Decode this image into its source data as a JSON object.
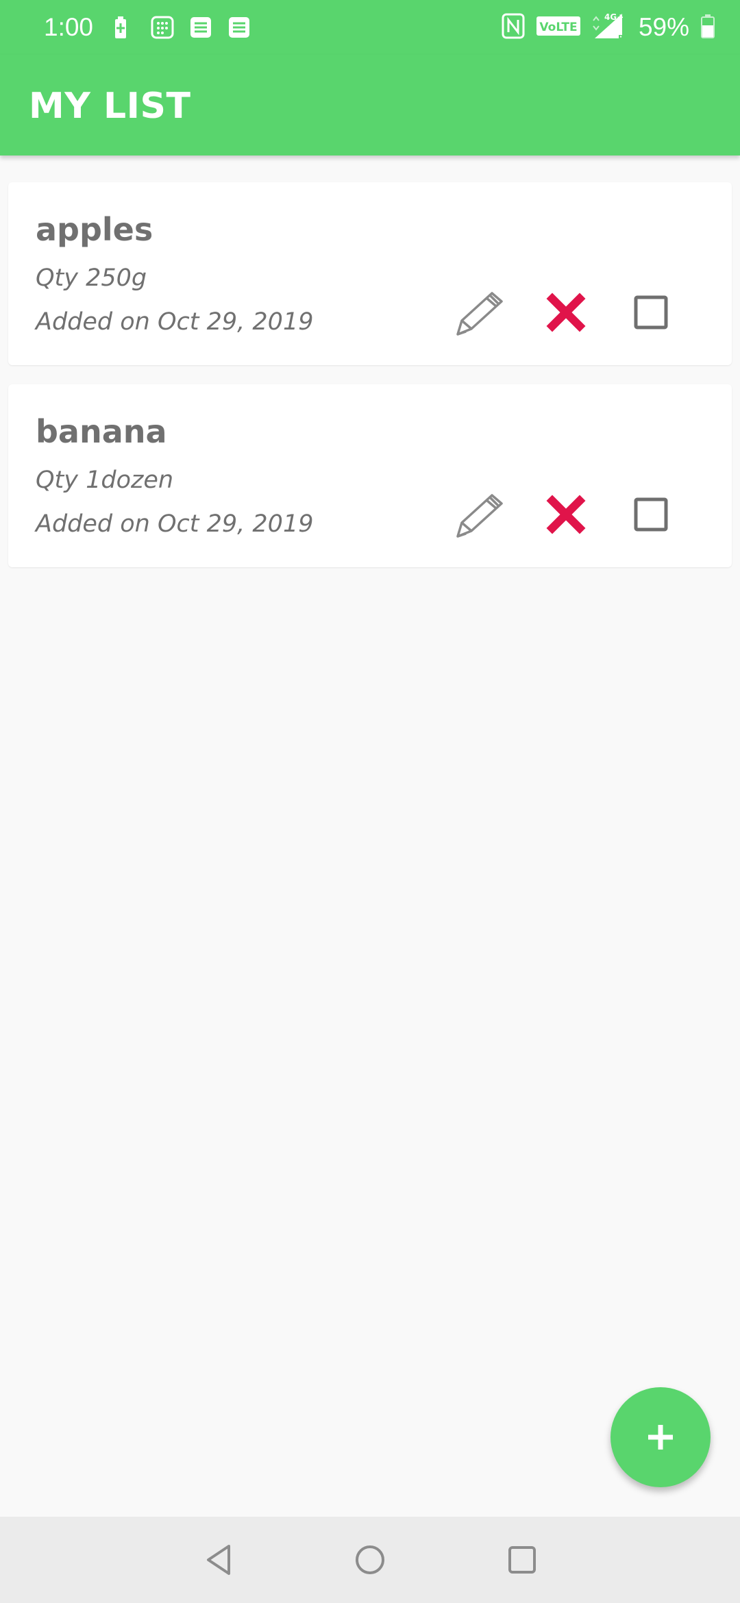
{
  "status_bar": {
    "time": "1:00",
    "battery_percent": "59%",
    "network_label": "VoLTE",
    "signal_label": "4G+",
    "roaming_label": "R",
    "left_icons": [
      "battery-charging-icon",
      "calculator-icon",
      "notes-icon",
      "notes-icon"
    ],
    "right_icons": [
      "nfc-icon",
      "volte-icon",
      "signal-icon",
      "battery-icon"
    ]
  },
  "app_bar": {
    "title": "MY LIST"
  },
  "items": [
    {
      "name": "apples",
      "qty": "Qty 250g",
      "added": "Added on Oct 29, 2019",
      "checked": false
    },
    {
      "name": "banana",
      "qty": "Qty 1dozen",
      "added": "Added on Oct 29, 2019",
      "checked": false
    }
  ],
  "fab": {
    "label": "+",
    "icon": "plus-icon"
  },
  "nav_bar": {
    "icons": [
      "back-triangle-icon",
      "home-circle-icon",
      "recents-square-icon"
    ]
  },
  "colors": {
    "primary": "#59d56d",
    "delete": "#e0144a",
    "text": "#707070",
    "background": "#f9f9f9"
  }
}
